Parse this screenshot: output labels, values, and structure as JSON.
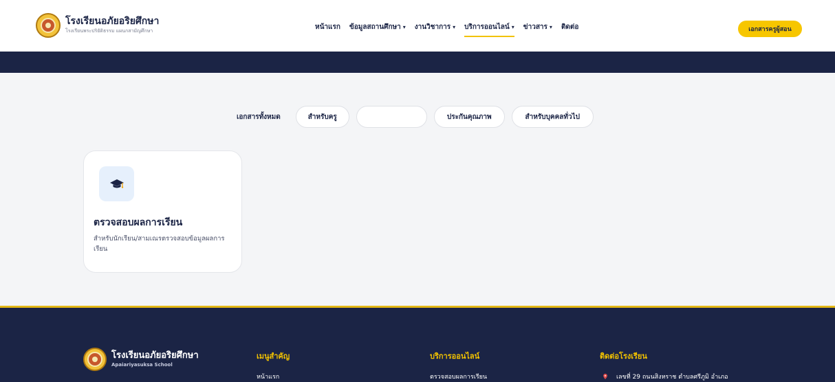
{
  "header": {
    "brand_name": "โรงเรียนอภัยอริยศึกษา",
    "brand_sub": "โรงเรียนพระปริยัติธรรม แผนกสามัญศึกษา",
    "nav": [
      {
        "label": "หน้าแรก",
        "caret": ""
      },
      {
        "label": "ข้อมูลสถานศึกษา",
        "caret": "▾"
      },
      {
        "label": "งานวิชาการ",
        "caret": "▾"
      },
      {
        "label": "บริการออนไลน์",
        "caret": "▾"
      },
      {
        "label": "ข่าวสาร",
        "caret": "▾"
      },
      {
        "label": "ติดต่อ",
        "caret": ""
      }
    ],
    "cta_label": "เอกสารครูผู้สอน"
  },
  "filters": {
    "label": "เอกสารทั้งหมด",
    "chips": [
      "สำหรับครู",
      "",
      "ประกันคุณภาพ",
      "สำหรับบุคคลทั่วไป"
    ]
  },
  "card": {
    "title": "ตรวจสอบผลการเรียน",
    "description": "สำหรับนักเรียน/สามเณรตรวจสอบข้อมูลผลการเรียน",
    "icon": "graduation-cap-icon"
  },
  "footer": {
    "brand_name": "โรงเรียนอภัยอริยศึกษา",
    "brand_sub": "Apaiariyasuksa School",
    "columns": [
      {
        "heading": "เมนูสำคัญ",
        "link": "หน้าแรก"
      },
      {
        "heading": "บริการออนไลน์",
        "link": "ตรวจสอบผลการเรียน"
      },
      {
        "heading": "ติดต่อโรงเรียน",
        "link": "เลขที่ 29 ถนนสิงหราช ตำบลศรีภูมิ อำเภอ"
      }
    ]
  },
  "colors": {
    "navy": "#1b2445",
    "accent_yellow": "#f7c600",
    "pin_red": "#e04a4a"
  }
}
